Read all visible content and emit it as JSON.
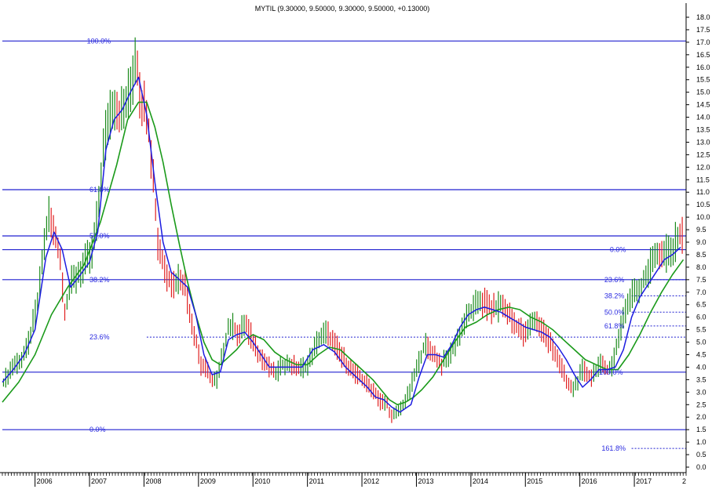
{
  "title": "MYTIL (9.30000, 9.50000, 9.30000, 9.50000, +0.13000)",
  "chart_data": {
    "type": "line",
    "ylim": [
      0,
      18
    ],
    "y_ticks": [
      "0.0",
      "0.5",
      "1.0",
      "1.5",
      "2.0",
      "2.5",
      "3.0",
      "3.5",
      "4.0",
      "4.5",
      "5.0",
      "5.5",
      "6.0",
      "6.5",
      "7.0",
      "7.5",
      "8.0",
      "8.5",
      "9.0",
      "9.5",
      "10.0",
      "10.5",
      "11.0",
      "11.5",
      "12.0",
      "12.5",
      "13.0",
      "13.5",
      "14.0",
      "14.5",
      "15.0",
      "15.5",
      "16.0",
      "16.5",
      "17.0",
      "17.5",
      "18.0"
    ],
    "x_years": [
      "2006",
      "2007",
      "2008",
      "2009",
      "2010",
      "2011",
      "2012",
      "2013",
      "2014",
      "2015",
      "2016",
      "2017"
    ],
    "x_trailing_label": "2",
    "grid": false,
    "price": {
      "x": [
        2005.4,
        2005.5,
        2005.6,
        2005.75,
        2005.85,
        2005.95,
        2006.05,
        2006.15,
        2006.25,
        2006.35,
        2006.45,
        2006.55,
        2006.65,
        2006.75,
        2006.85,
        2006.95,
        2007.05,
        2007.15,
        2007.25,
        2007.35,
        2007.45,
        2007.55,
        2007.65,
        2007.75,
        2007.85,
        2007.95,
        2008.05,
        2008.15,
        2008.25,
        2008.35,
        2008.45,
        2008.55,
        2008.65,
        2008.75,
        2008.85,
        2008.95,
        2009.05,
        2009.15,
        2009.25,
        2009.35,
        2009.45,
        2009.55,
        2009.65,
        2009.75,
        2009.85,
        2009.95,
        2010.1,
        2010.25,
        2010.4,
        2010.55,
        2010.7,
        2010.85,
        2011.0,
        2011.1,
        2011.2,
        2011.35,
        2011.5,
        2011.65,
        2011.8,
        2011.95,
        2012.1,
        2012.25,
        2012.35,
        2012.45,
        2012.55,
        2012.7,
        2012.85,
        2013.0,
        2013.15,
        2013.3,
        2013.45,
        2013.6,
        2013.75,
        2013.9,
        2014.05,
        2014.15,
        2014.25,
        2014.4,
        2014.55,
        2014.7,
        2014.85,
        2015.0,
        2015.15,
        2015.3,
        2015.45,
        2015.55,
        2015.65,
        2015.75,
        2015.85,
        2015.95,
        2016.05,
        2016.2,
        2016.35,
        2016.5,
        2016.6,
        2016.7,
        2016.8,
        2016.9,
        2017.0,
        2017.1,
        2017.2,
        2017.3,
        2017.4,
        2017.5,
        2017.6,
        2017.7,
        2017.8,
        2017.9
      ],
      "y": [
        3.3,
        3.7,
        4.1,
        4.3,
        4.7,
        5.6,
        6.6,
        8.6,
        10.1,
        9.3,
        8.6,
        6.2,
        7.3,
        7.6,
        7.9,
        8.3,
        8.6,
        10.1,
        12.6,
        14.1,
        14.6,
        14.1,
        14.3,
        15.1,
        16.6,
        14.6,
        14.2,
        12.2,
        9.1,
        8.1,
        7.6,
        7.3,
        7.6,
        7.3,
        6.1,
        5.1,
        4.1,
        3.9,
        3.4,
        3.5,
        4.6,
        5.6,
        5.6,
        5.3,
        5.8,
        5.3,
        4.6,
        4.1,
        3.7,
        4.1,
        4.1,
        3.9,
        4.1,
        4.6,
        5.1,
        5.4,
        4.9,
        4.4,
        3.9,
        3.6,
        3.3,
        3.0,
        2.6,
        2.6,
        2.0,
        2.3,
        2.9,
        3.9,
        4.9,
        4.6,
        4.1,
        4.4,
        5.1,
        5.9,
        6.3,
        6.7,
        6.6,
        6.3,
        6.5,
        6.1,
        5.6,
        5.3,
        5.9,
        5.6,
        5.0,
        4.6,
        4.1,
        3.4,
        3.1,
        3.4,
        3.9,
        3.6,
        4.1,
        3.9,
        4.1,
        5.1,
        6.1,
        6.6,
        7.1,
        7.1,
        7.6,
        8.1,
        8.6,
        8.4,
        8.6,
        8.6,
        9.3,
        9.2
      ]
    },
    "ma_short": {
      "x": [
        2005.4,
        2005.6,
        2005.8,
        2006.0,
        2006.2,
        2006.35,
        2006.5,
        2006.65,
        2006.8,
        2007.0,
        2007.15,
        2007.3,
        2007.45,
        2007.6,
        2007.75,
        2007.9,
        2008.05,
        2008.2,
        2008.35,
        2008.5,
        2008.65,
        2008.8,
        2008.95,
        2009.1,
        2009.25,
        2009.4,
        2009.55,
        2009.7,
        2009.85,
        2010.0,
        2010.15,
        2010.3,
        2010.5,
        2010.7,
        2010.9,
        2011.1,
        2011.3,
        2011.5,
        2011.7,
        2011.9,
        2012.1,
        2012.25,
        2012.4,
        2012.55,
        2012.7,
        2012.9,
        2013.05,
        2013.2,
        2013.35,
        2013.5,
        2013.65,
        2013.8,
        2013.95,
        2014.1,
        2014.25,
        2014.4,
        2014.55,
        2014.7,
        2014.85,
        2015.0,
        2015.15,
        2015.3,
        2015.45,
        2015.6,
        2015.75,
        2015.9,
        2016.05,
        2016.2,
        2016.35,
        2016.5,
        2016.65,
        2016.8,
        2016.95,
        2017.1,
        2017.25,
        2017.4,
        2017.55,
        2017.7,
        2017.85
      ],
      "y": [
        3.4,
        3.9,
        4.5,
        5.5,
        8.4,
        9.4,
        8.7,
        7.2,
        7.6,
        8.2,
        9.4,
        12.7,
        13.9,
        14.3,
        15.0,
        15.6,
        14.1,
        11.4,
        9.0,
        7.8,
        7.5,
        7.2,
        6.1,
        4.5,
        3.7,
        3.8,
        5.1,
        5.3,
        5.4,
        5.0,
        4.5,
        4.0,
        4.0,
        4.0,
        4.0,
        4.7,
        4.9,
        4.6,
        4.0,
        3.6,
        3.2,
        2.8,
        2.7,
        2.4,
        2.2,
        2.5,
        3.6,
        4.5,
        4.5,
        4.4,
        4.9,
        5.6,
        6.1,
        6.3,
        6.4,
        6.3,
        6.2,
        6.0,
        5.8,
        5.6,
        5.5,
        5.4,
        5.2,
        4.8,
        4.3,
        3.7,
        3.2,
        3.5,
        3.9,
        3.9,
        4.0,
        4.7,
        6.0,
        6.8,
        7.3,
        7.8,
        8.3,
        8.5,
        8.8
      ]
    },
    "ma_long": {
      "x": [
        2005.4,
        2005.7,
        2006.0,
        2006.3,
        2006.6,
        2006.9,
        2007.2,
        2007.5,
        2007.7,
        2007.9,
        2008.05,
        2008.2,
        2008.35,
        2008.5,
        2008.65,
        2008.8,
        2008.95,
        2009.1,
        2009.25,
        2009.4,
        2009.55,
        2009.7,
        2009.85,
        2010.0,
        2010.2,
        2010.4,
        2010.6,
        2010.8,
        2011.0,
        2011.2,
        2011.4,
        2011.6,
        2011.8,
        2012.0,
        2012.2,
        2012.35,
        2012.5,
        2012.65,
        2012.8,
        2012.95,
        2013.1,
        2013.3,
        2013.5,
        2013.7,
        2013.9,
        2014.1,
        2014.3,
        2014.5,
        2014.7,
        2014.9,
        2015.1,
        2015.3,
        2015.5,
        2015.7,
        2015.9,
        2016.1,
        2016.3,
        2016.5,
        2016.7,
        2016.9,
        2017.1,
        2017.3,
        2017.5,
        2017.7,
        2017.9
      ],
      "y": [
        2.6,
        3.4,
        4.5,
        6.1,
        7.2,
        8.1,
        9.8,
        12.1,
        13.9,
        14.6,
        14.6,
        13.6,
        12.2,
        10.5,
        8.9,
        7.4,
        6.1,
        5.0,
        4.3,
        4.1,
        4.4,
        4.7,
        5.1,
        5.3,
        5.1,
        4.6,
        4.3,
        4.1,
        4.1,
        4.5,
        4.8,
        4.7,
        4.3,
        3.9,
        3.5,
        3.1,
        2.7,
        2.5,
        2.6,
        2.8,
        3.1,
        3.6,
        4.3,
        5.0,
        5.6,
        5.8,
        6.1,
        6.3,
        6.4,
        6.3,
        6.0,
        5.8,
        5.5,
        5.1,
        4.7,
        4.3,
        4.1,
        3.9,
        3.9,
        4.5,
        5.3,
        6.2,
        7.0,
        7.7,
        8.3
      ]
    },
    "horizontal_levels": [
      {
        "value": 17.05,
        "label": "100.0%",
        "label_x": 2006.95,
        "dotted": false
      },
      {
        "value": 11.1,
        "label": "61.8%",
        "label_x": 2007.0,
        "dotted": false
      },
      {
        "value": 9.25,
        "label": "50.0%",
        "label_x": 2007.0,
        "dotted": false
      },
      {
        "value": 8.7,
        "label": "0.0%",
        "label_x": 2016.55,
        "dotted": false
      },
      {
        "value": 7.5,
        "label": "38.2%",
        "label_x": 2007.0,
        "dotted": false
      },
      {
        "value": 3.8,
        "label": "100.0%",
        "label_x": 2016.35,
        "dotted": false
      },
      {
        "value": 1.5,
        "label": "0.0%",
        "label_x": 2007.0,
        "dotted": false
      },
      {
        "value": 5.2,
        "label": "23.6%",
        "label_x": 2007.0,
        "dotted": true,
        "from_x": 2008.05
      },
      {
        "value": 7.5,
        "label": "23.6%",
        "label_x": 2016.45,
        "dotted": true,
        "from_x": 2016.95
      },
      {
        "value": 6.85,
        "label": "38.2%",
        "label_x": 2016.45,
        "dotted": true,
        "from_x": 2016.95
      },
      {
        "value": 6.2,
        "label": "50.0%",
        "label_x": 2016.45,
        "dotted": true,
        "from_x": 2016.95
      },
      {
        "value": 5.65,
        "label": "61.8%",
        "label_x": 2016.45,
        "dotted": true,
        "from_x": 2016.95
      },
      {
        "value": 0.75,
        "label": "161.8%",
        "label_x": 2016.4,
        "dotted": true,
        "from_x": 2016.95
      }
    ],
    "colors": {
      "price_up": "#1a8a1a",
      "price_down": "#e02020",
      "ma_short": "#1c1ce0",
      "ma_long": "#1a9a1a",
      "levels": "#2020d0"
    }
  }
}
